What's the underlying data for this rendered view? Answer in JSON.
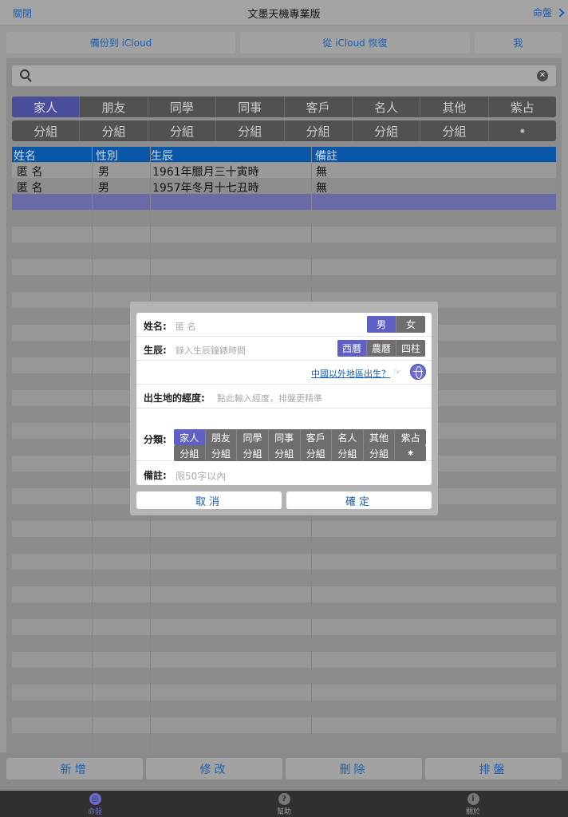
{
  "nav": {
    "left": "關閉",
    "title": "文墨天機專業版",
    "right": "命盤"
  },
  "top_buttons": {
    "backup": "備份到 iCloud",
    "restore": "從 iCloud 恢復",
    "me": "我"
  },
  "search": {
    "placeholder": ""
  },
  "category_tabs": [
    "家人",
    "朋友",
    "同學",
    "同事",
    "客戶",
    "名人",
    "其他",
    "紫占"
  ],
  "group_tabs": [
    "分組",
    "分組",
    "分組",
    "分組",
    "分組",
    "分組",
    "分組",
    "⁕"
  ],
  "table": {
    "headers": {
      "name": "姓名",
      "gender": "性別",
      "birth": "生辰",
      "note": "備註"
    },
    "rows": [
      {
        "name": "匿 名",
        "gender": "男",
        "birth": "1961年臘月三十寅時",
        "note": "無"
      },
      {
        "name": "匿 名",
        "gender": "男",
        "birth": "1957年冬月十七丑時",
        "note": "無"
      }
    ]
  },
  "dialog": {
    "name_label": "姓名:",
    "name_placeholder": "匿 名",
    "gender": [
      "男",
      "女"
    ],
    "birth_label": "生辰:",
    "birth_placeholder": "錄入生辰鐘錶時間",
    "calendar": [
      "西曆",
      "農曆",
      "四柱"
    ],
    "overseas_link": "中國以外地區出生？",
    "pointer_glyph": "☞",
    "longitude_label": "出生地的經度:",
    "longitude_placeholder": "點此輸入經度，排盤更精準",
    "category_label": "分類:",
    "categories": [
      "家人",
      "朋友",
      "同學",
      "同事",
      "客戶",
      "名人",
      "其他",
      "紫占"
    ],
    "groups": [
      "分組",
      "分組",
      "分組",
      "分組",
      "分組",
      "分組",
      "分組",
      "⁕"
    ],
    "note_label": "備註:",
    "note_placeholder": "限50字以內",
    "cancel": "取消",
    "confirm": "確定"
  },
  "bottom_buttons": {
    "add": "新增",
    "edit": "修改",
    "delete": "刪除",
    "chart": "排盤"
  },
  "tabbar": [
    {
      "label": "命盤",
      "icon": "chart-icon"
    },
    {
      "label": "幫助",
      "icon": "help-icon"
    },
    {
      "label": "關於",
      "icon": "info-icon"
    }
  ],
  "colors": {
    "accent": "#1a5fb4",
    "selected_segment": "#5f5fc4",
    "header": "#0a56a8"
  }
}
